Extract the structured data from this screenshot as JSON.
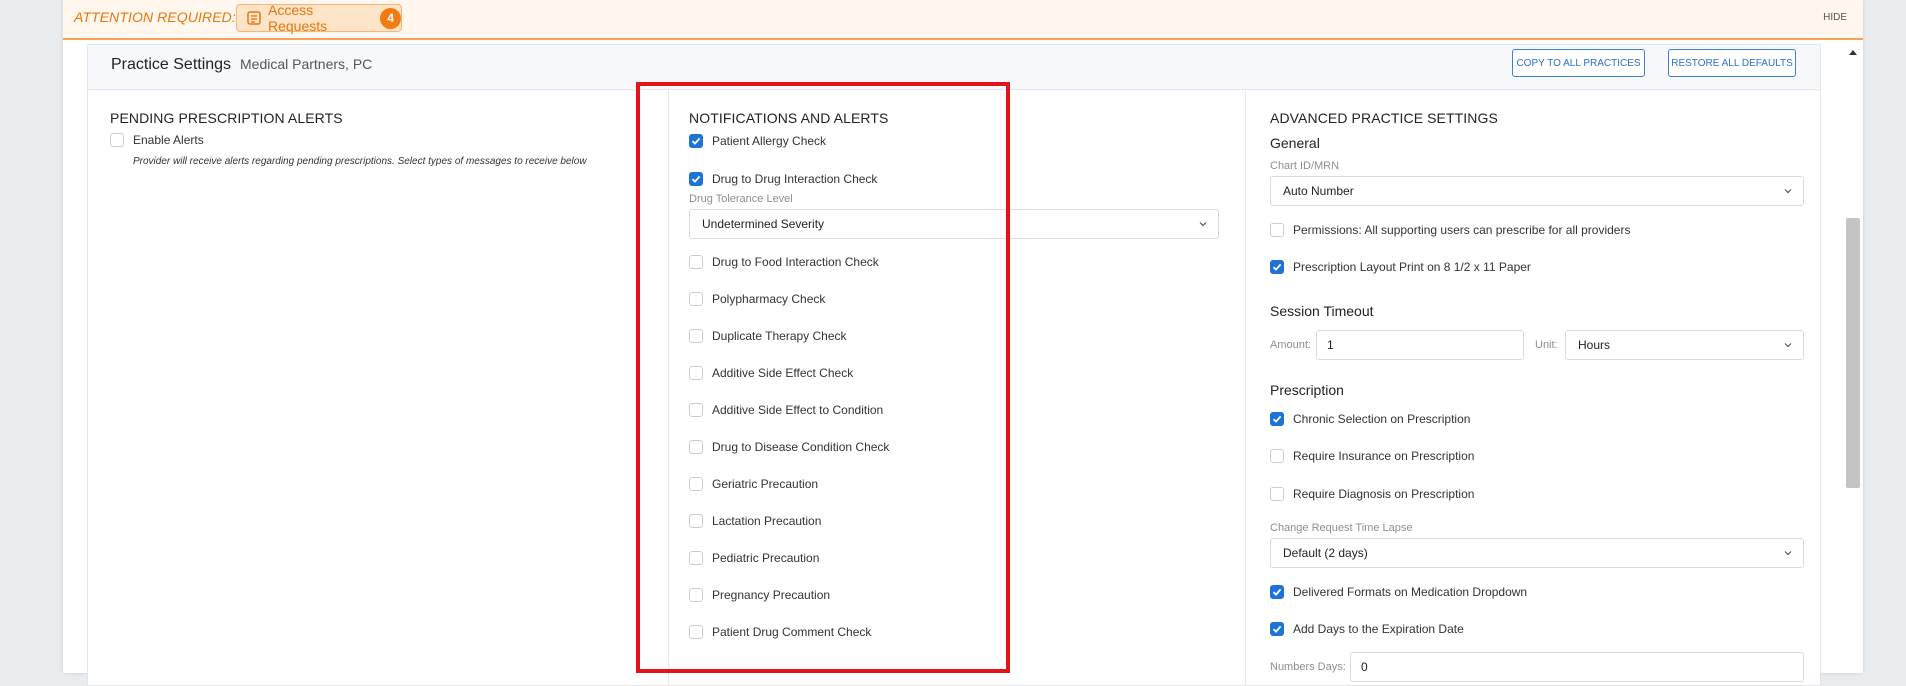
{
  "attention": {
    "title": "ATTENTION REQUIRED:",
    "access_label": "Access Requests",
    "access_count": "4",
    "hide_label": "HIDE"
  },
  "header": {
    "title": "Practice Settings",
    "practice_name": "Medical Partners, PC",
    "copy_label": "COPY TO ALL PRACTICES",
    "restore_label": "RESTORE ALL DEFAULTS"
  },
  "pending": {
    "title": "PENDING PRESCRIPTION ALERTS",
    "enable_label": "Enable Alerts",
    "enable_checked": false,
    "note": "Provider will receive alerts regarding pending prescriptions. Select types of messages to receive below"
  },
  "notifications": {
    "title": "NOTIFICATIONS AND ALERTS",
    "patient_allergy": {
      "label": "Patient Allergy Check",
      "checked": true
    },
    "drug_drug": {
      "label": "Drug to Drug Interaction Check",
      "checked": true
    },
    "tolerance_label": "Drug Tolerance Level",
    "tolerance_value": "Undetermined Severity",
    "items": [
      {
        "label": "Drug to Food Interaction Check",
        "checked": false
      },
      {
        "label": "Polypharmacy Check",
        "checked": false
      },
      {
        "label": "Duplicate Therapy Check",
        "checked": false
      },
      {
        "label": "Additive Side Effect Check",
        "checked": false
      },
      {
        "label": "Additive Side Effect to Condition",
        "checked": false
      },
      {
        "label": "Drug to Disease Condition Check",
        "checked": false
      },
      {
        "label": "Geriatric Precaution",
        "checked": false
      },
      {
        "label": "Lactation Precaution",
        "checked": false
      },
      {
        "label": "Pediatric Precaution",
        "checked": false
      },
      {
        "label": "Pregnancy Precaution",
        "checked": false
      },
      {
        "label": "Patient Drug Comment Check",
        "checked": false
      }
    ]
  },
  "advanced": {
    "title": "ADVANCED PRACTICE SETTINGS",
    "general_title": "General",
    "chart_label": "Chart ID/MRN",
    "chart_value": "Auto Number",
    "permissions": {
      "label": "Permissions: All supporting users can prescribe for all providers",
      "checked": false
    },
    "layout_print": {
      "label": "Prescription Layout Print on 8 1/2 x 11 Paper",
      "checked": true
    },
    "session_title": "Session Timeout",
    "amount_label": "Amount:",
    "amount_value": "1",
    "unit_label": "Unit:",
    "unit_value": "Hours",
    "prescription_title": "Prescription",
    "chronic": {
      "label": "Chronic Selection on Prescription",
      "checked": true
    },
    "insurance": {
      "label": "Require Insurance on Prescription",
      "checked": false
    },
    "diagnosis": {
      "label": "Require Diagnosis on Prescription",
      "checked": false
    },
    "lapse_label": "Change Request Time Lapse",
    "lapse_value": "Default (2 days)",
    "delivered": {
      "label": "Delivered Formats on Medication Dropdown",
      "checked": true
    },
    "add_days": {
      "label": "Add Days to the Expiration Date",
      "checked": true
    },
    "numbers_label": "Numbers Days:",
    "numbers_value": "0"
  },
  "colors": {
    "accent": "#1e73d8",
    "attention": "#e8770c",
    "highlight": "#e3131b"
  }
}
